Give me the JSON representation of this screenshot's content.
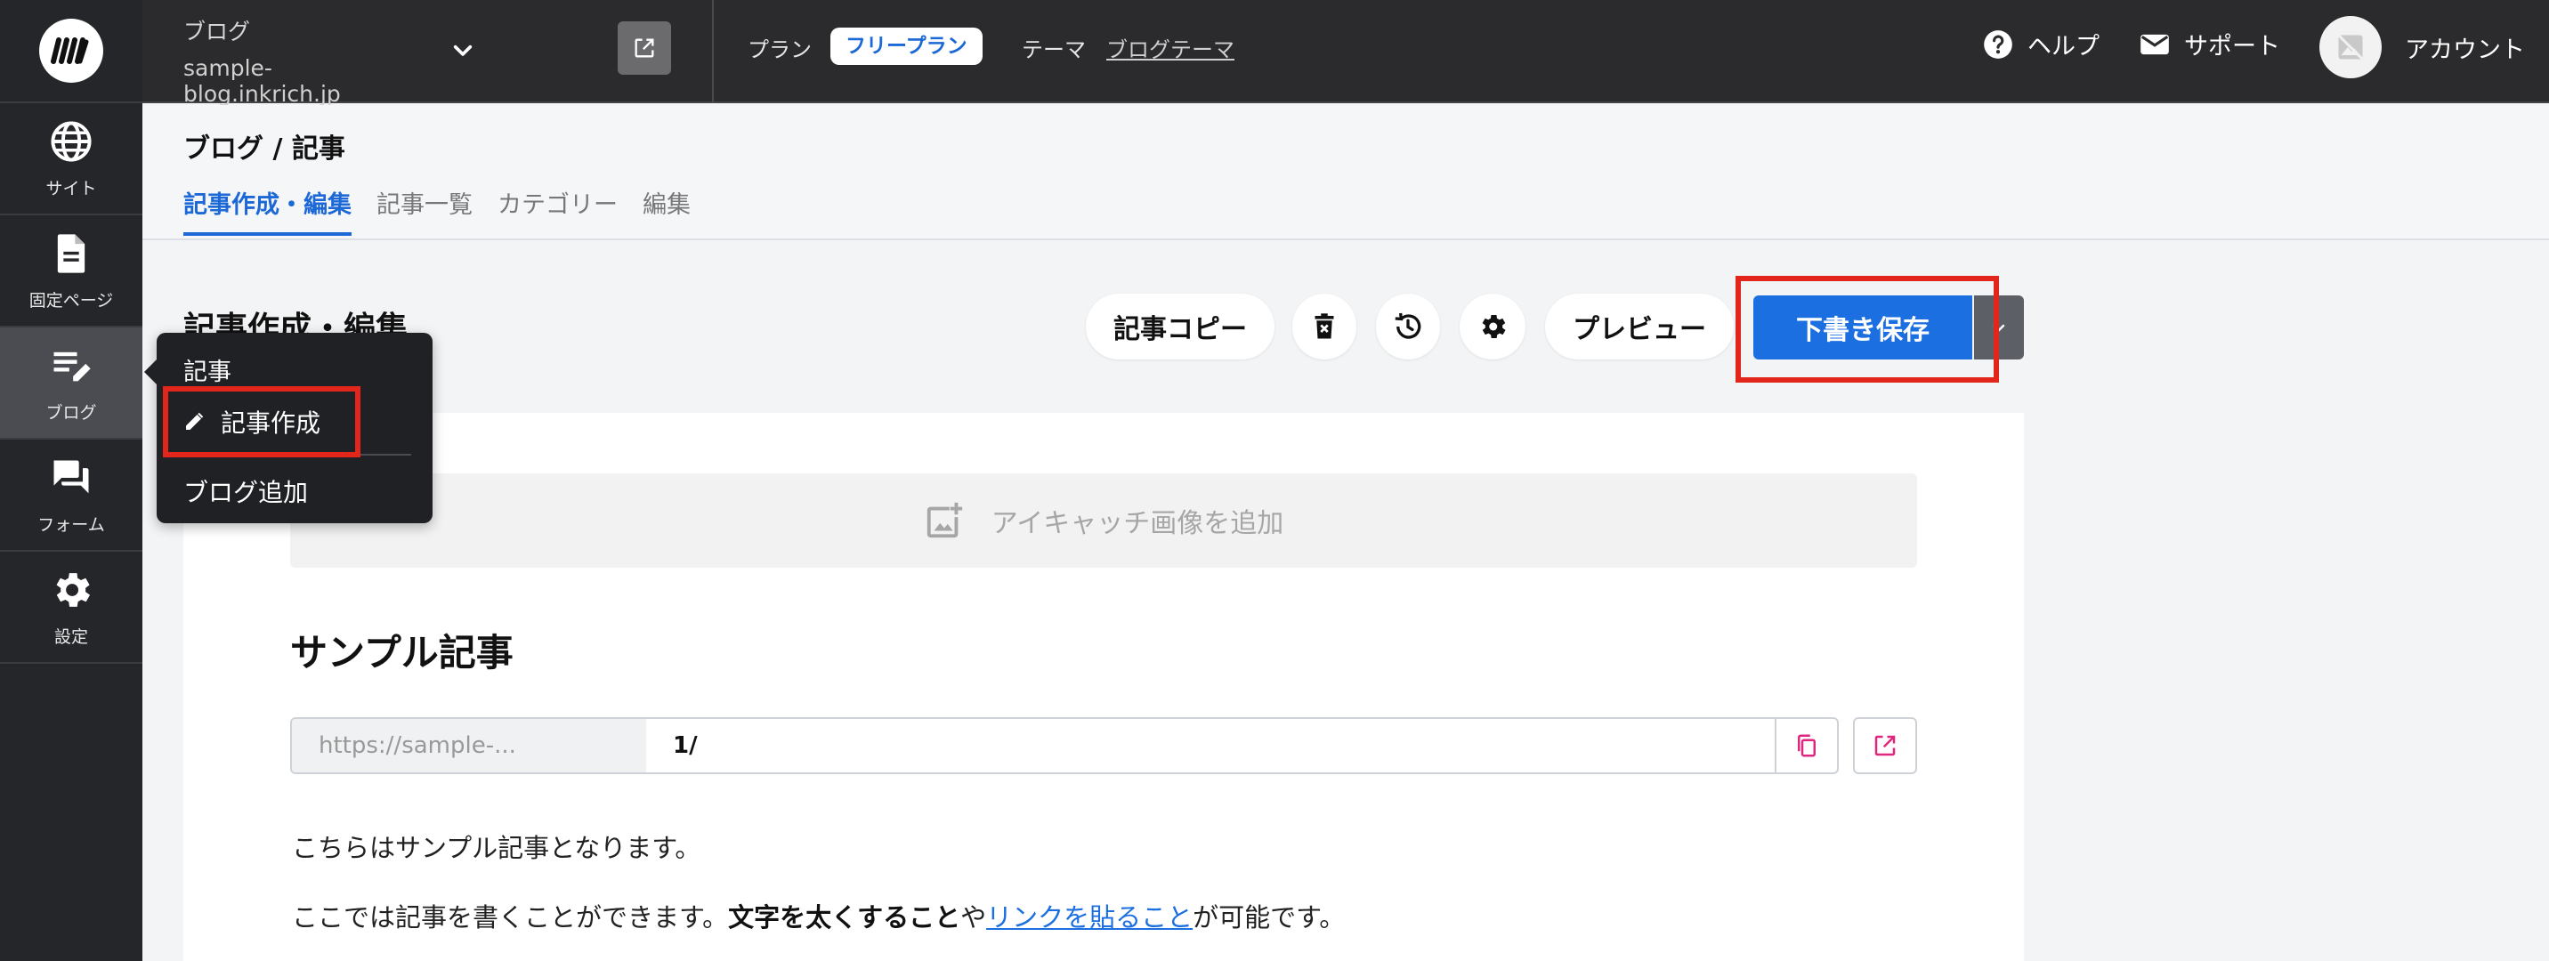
{
  "sidebar": {
    "items": [
      {
        "label": "サイト",
        "icon": "globe-icon"
      },
      {
        "label": "固定ページ",
        "icon": "document-icon"
      },
      {
        "label": "ブログ",
        "icon": "blog-edit-icon"
      },
      {
        "label": "フォーム",
        "icon": "forum-icon"
      },
      {
        "label": "設定",
        "icon": "gear-icon"
      }
    ]
  },
  "header": {
    "blog_type": "ブログ",
    "blog_domain": "sample-blog.inkrich.jp",
    "plan_label": "プラン",
    "plan_value": "フリープラン",
    "theme_label": "テーマ",
    "theme_value": "ブログテーマ",
    "help_label": "ヘルプ",
    "support_label": "サポート",
    "account_label": "アカウント"
  },
  "subheader": {
    "breadcrumb": "ブログ / 記事",
    "tabs": [
      {
        "label": "記事作成・編集",
        "active": true
      },
      {
        "label": "記事一覧",
        "active": false
      },
      {
        "label": "カテゴリー",
        "active": false
      },
      {
        "label": "編集",
        "active": false
      }
    ]
  },
  "editor": {
    "section_title": "記事作成・編集",
    "copy_label": "記事コピー",
    "preview_label": "プレビュー",
    "save_draft_label": "下書き保存",
    "eyecatch_label": "アイキャッチ画像を追加",
    "article_title": "サンプル記事",
    "url_prefix": "https://sample-...",
    "url_slug": "1/",
    "paragraph1": "こちらはサンプル記事となります。",
    "paragraph2": {
      "part1": "ここでは記事を書くことができます。",
      "bold": "文字を太くすること",
      "part2": "や",
      "link": "リンクを貼ること",
      "part3": "が可能です。"
    }
  },
  "flyout": {
    "heading": "記事",
    "create_label": "記事作成",
    "add_blog_label": "ブログ追加"
  },
  "colors": {
    "accent": "#1b6fe0",
    "highlight": "#e3261c",
    "url_icon": "#e0267d"
  }
}
